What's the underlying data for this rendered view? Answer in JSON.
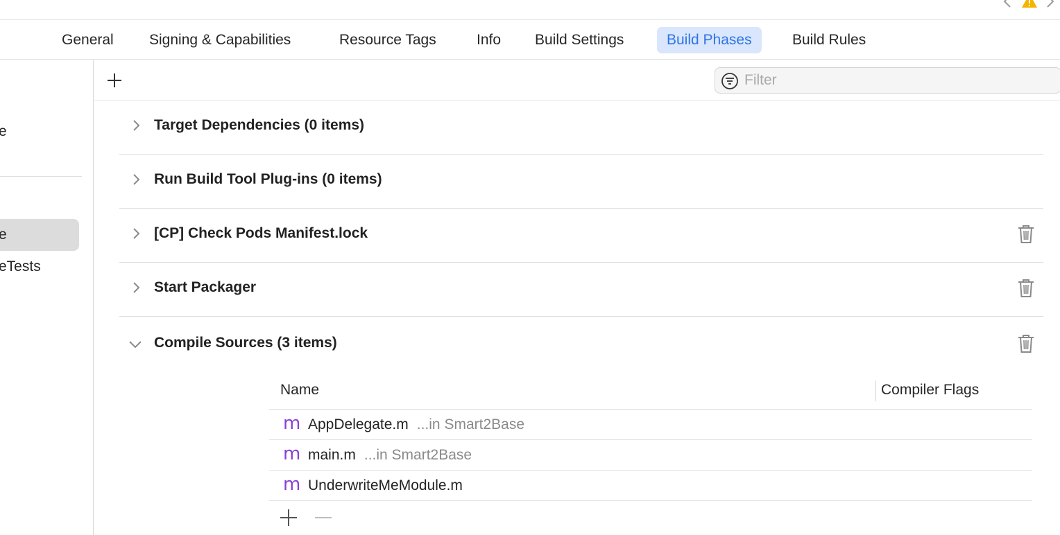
{
  "tabs": [
    {
      "label": "General",
      "selected": false
    },
    {
      "label": "Signing & Capabilities",
      "selected": false
    },
    {
      "label": "Resource Tags",
      "selected": false
    },
    {
      "label": "Info",
      "selected": false
    },
    {
      "label": "Build Settings",
      "selected": false
    },
    {
      "label": "Build Phases",
      "selected": true
    },
    {
      "label": "Build Rules",
      "selected": false
    }
  ],
  "sidebar": {
    "project_item_fragment": "e",
    "targets": [
      {
        "label": "e",
        "selected": true
      },
      {
        "label": "eTests",
        "selected": false
      }
    ]
  },
  "toolbar": {
    "filter_placeholder": "Filter"
  },
  "phases": [
    {
      "title": "Target Dependencies (0 items)",
      "expanded": false,
      "deletable": false
    },
    {
      "title": "Run Build Tool Plug-ins (0 items)",
      "expanded": false,
      "deletable": false
    },
    {
      "title": "[CP] Check Pods Manifest.lock",
      "expanded": false,
      "deletable": true
    },
    {
      "title": "Start Packager",
      "expanded": false,
      "deletable": true
    }
  ],
  "compile_sources": {
    "title": "Compile Sources (3 items)",
    "expanded": true,
    "columns": {
      "name": "Name",
      "flags": "Compiler Flags"
    },
    "files": [
      {
        "icon": "m",
        "name": "AppDelegate.m",
        "location": "...in Smart2Base"
      },
      {
        "icon": "m",
        "name": "main.m",
        "location": "...in Smart2Base"
      },
      {
        "icon": "m",
        "name": "UnderwriteMeModule.m",
        "location": ""
      }
    ]
  },
  "colors": {
    "accent": "#2f74e8",
    "tab_selected_bg": "#d9e6fb",
    "warning": "#f4b400",
    "objc_file": "#8a3fd6"
  }
}
